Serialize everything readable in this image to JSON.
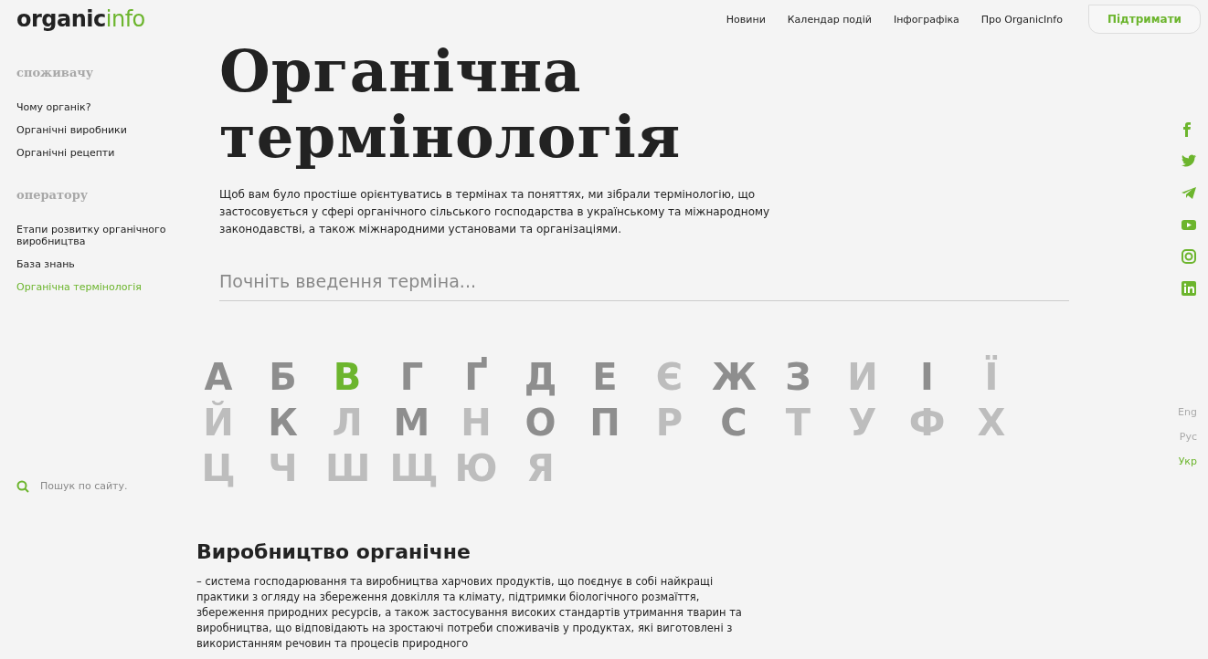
{
  "logo": {
    "part_1": "organic",
    "part_2": "info"
  },
  "nav": [
    {
      "label": "Новини"
    },
    {
      "label": "Календар подій"
    },
    {
      "label": "Інфографіка"
    },
    {
      "label": "Про OrganicInfo"
    }
  ],
  "support_button": "Підтримати",
  "sidebar": {
    "groups": [
      {
        "heading": "споживачу",
        "items": [
          {
            "label": "Чому органік?",
            "selected": false
          },
          {
            "label": "Органічні виробники",
            "selected": false
          },
          {
            "label": "Органічні рецепти",
            "selected": false
          }
        ]
      },
      {
        "heading": "оператору",
        "items": [
          {
            "label": "Етапи розвитку органічного виробництва",
            "selected": false
          },
          {
            "label": "База знань",
            "selected": false
          },
          {
            "label": "Органічна термінологія",
            "selected": true
          }
        ]
      }
    ],
    "search": {
      "placeholder": "Пошук по сайту."
    }
  },
  "page": {
    "title": "Органічна термінологія",
    "intro": "Щоб вам було простіше орієнтуватись в термінах та поняттях, ми зібрали термінологію, що застосовується у сфері органічного сільського господарства в українському та міжнародному законодавстві, а також міжнародними установами та організаціями.",
    "term_search": {
      "placeholder": "Почніть введення терміна..."
    },
    "alphabet": [
      {
        "letter": "А",
        "available": true,
        "selected": false
      },
      {
        "letter": "Б",
        "available": true,
        "selected": false
      },
      {
        "letter": "В",
        "available": true,
        "selected": true
      },
      {
        "letter": "Г",
        "available": true,
        "selected": false
      },
      {
        "letter": "Ґ",
        "available": true,
        "selected": false
      },
      {
        "letter": "Д",
        "available": true,
        "selected": false
      },
      {
        "letter": "Е",
        "available": true,
        "selected": false
      },
      {
        "letter": "Є",
        "available": false,
        "selected": false
      },
      {
        "letter": "Ж",
        "available": true,
        "selected": false
      },
      {
        "letter": "З",
        "available": true,
        "selected": false
      },
      {
        "letter": "И",
        "available": false,
        "selected": false
      },
      {
        "letter": "І",
        "available": true,
        "selected": false
      },
      {
        "letter": "Ї",
        "available": false,
        "selected": false
      },
      {
        "letter": "Й",
        "available": false,
        "selected": false
      },
      {
        "letter": "К",
        "available": true,
        "selected": false
      },
      {
        "letter": "Л",
        "available": false,
        "selected": false
      },
      {
        "letter": "М",
        "available": true,
        "selected": false
      },
      {
        "letter": "Н",
        "available": false,
        "selected": false
      },
      {
        "letter": "О",
        "available": true,
        "selected": false
      },
      {
        "letter": "П",
        "available": true,
        "selected": false
      },
      {
        "letter": "Р",
        "available": false,
        "selected": false
      },
      {
        "letter": "С",
        "available": true,
        "selected": false
      },
      {
        "letter": "Т",
        "available": false,
        "selected": false
      },
      {
        "letter": "У",
        "available": false,
        "selected": false
      },
      {
        "letter": "Ф",
        "available": false,
        "selected": false
      },
      {
        "letter": "Х",
        "available": false,
        "selected": false
      },
      {
        "letter": "Ц",
        "available": false,
        "selected": false
      },
      {
        "letter": "Ч",
        "available": false,
        "selected": false
      },
      {
        "letter": "Ш",
        "available": false,
        "selected": false
      },
      {
        "letter": "Щ",
        "available": false,
        "selected": false
      },
      {
        "letter": "Ю",
        "available": false,
        "selected": false
      },
      {
        "letter": "Я",
        "available": false,
        "selected": false
      }
    ],
    "term": {
      "heading": "Виробництво органічне",
      "definition": "– система господарювання та виробництва харчових продуктів, що поєднує в собі найкращі практики з огляду на збереження довкілля та клімату, підтримки біологічного розмаїття, збереження природних ресурсів, а також застосування високих стандартів утримання тварин та виробництва, що відповідають на зростаючі потреби споживачів у продуктах, які виготовлені з використанням речовин та процесів природного"
    }
  },
  "social": [
    {
      "kind": "facebook"
    },
    {
      "kind": "twitter"
    },
    {
      "kind": "telegram"
    },
    {
      "kind": "youtube"
    },
    {
      "kind": "instagram"
    },
    {
      "kind": "linkedin"
    }
  ],
  "languages": [
    {
      "label": "Eng",
      "selected": false
    },
    {
      "label": "Рус",
      "selected": false
    },
    {
      "label": "Укр",
      "selected": true
    }
  ]
}
